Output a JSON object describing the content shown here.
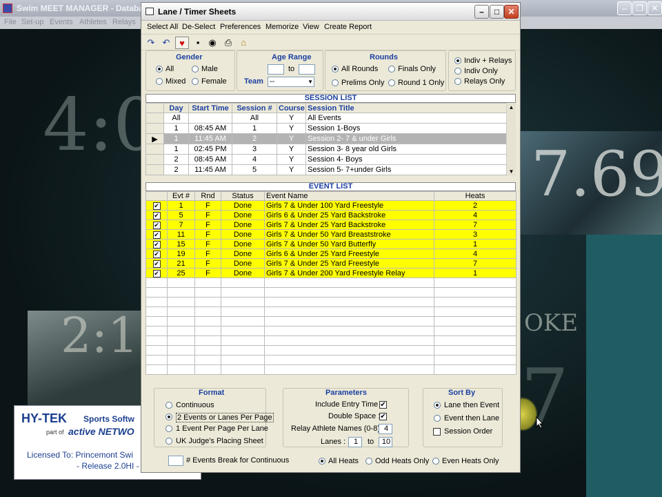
{
  "app": {
    "title": "Swim MEET MANAGER - Databa",
    "menu": [
      "File",
      "Set-up",
      "Events",
      "Athletes",
      "Relays"
    ],
    "deco": {
      "time1": "4:0",
      "time2": "7.69",
      "time3": "2:1",
      "word": "OKE",
      "num": "7"
    },
    "hytek": {
      "logo": "HY-TEK",
      "sub": "Sports Softw",
      "part_of": "part of",
      "active": "active NETWO",
      "licensed": "Licensed To:  Princemont Swi",
      "release": "- Release 2.0HI -"
    }
  },
  "dialog": {
    "title": "Lane / Timer Sheets",
    "menu": [
      "Select All",
      "De-Select",
      "Preferences",
      "Memorize",
      "View",
      "Create Report"
    ],
    "gender": {
      "title": "Gender",
      "options": [
        "All",
        "Male",
        "Mixed",
        "Female"
      ],
      "selected": "All"
    },
    "age": {
      "title": "Age Range",
      "to": "to",
      "from_value": "",
      "to_value": "",
      "team_label": "Team",
      "team_value": "--"
    },
    "rounds": {
      "title": "Rounds",
      "options": [
        "All Rounds",
        "Finals Only",
        "Prelims Only",
        "Round 1 Only"
      ],
      "selected": "All Rounds"
    },
    "relay_filter": {
      "options": [
        "Indiv + Relays",
        "Indiv Only",
        "Relays Only"
      ],
      "selected": "Indiv + Relays"
    },
    "session_list": {
      "title": "SESSION LIST",
      "headers": [
        "Day",
        "Start Time",
        "Session #",
        "Course",
        "Session Title"
      ],
      "rows": [
        [
          "All",
          "",
          "All",
          "Y",
          "All Events"
        ],
        [
          "1",
          "08:45 AM",
          "1",
          "Y",
          "Session 1-Boys"
        ],
        [
          "1",
          "11:45 AM",
          "2",
          "Y",
          "Session 2- 7 & under Girls"
        ],
        [
          "1",
          "02:45 PM",
          "3",
          "Y",
          "Session 3- 8 year old Girls"
        ],
        [
          "2",
          "08:45 AM",
          "4",
          "Y",
          "Session 4-  Boys"
        ],
        [
          "2",
          "11:45 AM",
          "5",
          "Y",
          "Session 5- 7+under Girls"
        ]
      ],
      "selected_index": 2
    },
    "event_list": {
      "title": "EVENT LIST",
      "headers": [
        "",
        "Evt #",
        "Rnd",
        "Status",
        "Event Name",
        "Heats"
      ],
      "rows": [
        [
          "✔",
          "1",
          "F",
          "Done",
          "Girls 7 & Under 100 Yard Freestyle",
          "2"
        ],
        [
          "✔",
          "5",
          "F",
          "Done",
          "Girls 6 & Under 25 Yard Backstroke",
          "4"
        ],
        [
          "✔",
          "7",
          "F",
          "Done",
          "Girls 7 & Under 25 Yard Backstroke",
          "7"
        ],
        [
          "✔",
          "11",
          "F",
          "Done",
          "Girls 7 & Under 50 Yard Breaststroke",
          "3"
        ],
        [
          "✔",
          "15",
          "F",
          "Done",
          "Girls 7 & Under 50 Yard Butterfly",
          "1"
        ],
        [
          "✔",
          "19",
          "F",
          "Done",
          "Girls 6 & Under 25 Yard Freestyle",
          "4"
        ],
        [
          "✔",
          "21",
          "F",
          "Done",
          "Girls 7 & Under 25 Yard Freestyle",
          "7"
        ],
        [
          "✔",
          "25",
          "F",
          "Done",
          "Girls 7 & Under 200 Yard Freestyle Relay",
          "1"
        ]
      ]
    },
    "format": {
      "title": "Format",
      "options": [
        "Continuous",
        "2 Events or Lanes Per Page",
        "1 Event Per Page Per Lane",
        "UK Judge's Placing Sheet"
      ],
      "selected": "2 Events or Lanes Per Page",
      "break_value": "",
      "break_label": "# Events Break for Continuous"
    },
    "parameters": {
      "title": "Parameters",
      "include_entry_time": "Include Entry Time :",
      "include_entry_checked": "✔",
      "double_space": "Double Space :",
      "double_space_checked": "✔",
      "relay_names": "Relay Athlete Names (0-8) :",
      "relay_names_value": "4",
      "lanes": "Lanes :",
      "lanes_from": "1",
      "to": "to",
      "lanes_to": "10"
    },
    "sort_by": {
      "title": "Sort By",
      "options": [
        "Lane then Event",
        "Event then Lane"
      ],
      "selected": "Lane then Event",
      "session_order": "Session Order"
    },
    "heats": {
      "options": [
        "All Heats",
        "Odd Heats Only",
        "Even Heats Only"
      ],
      "selected": "All Heats"
    }
  }
}
